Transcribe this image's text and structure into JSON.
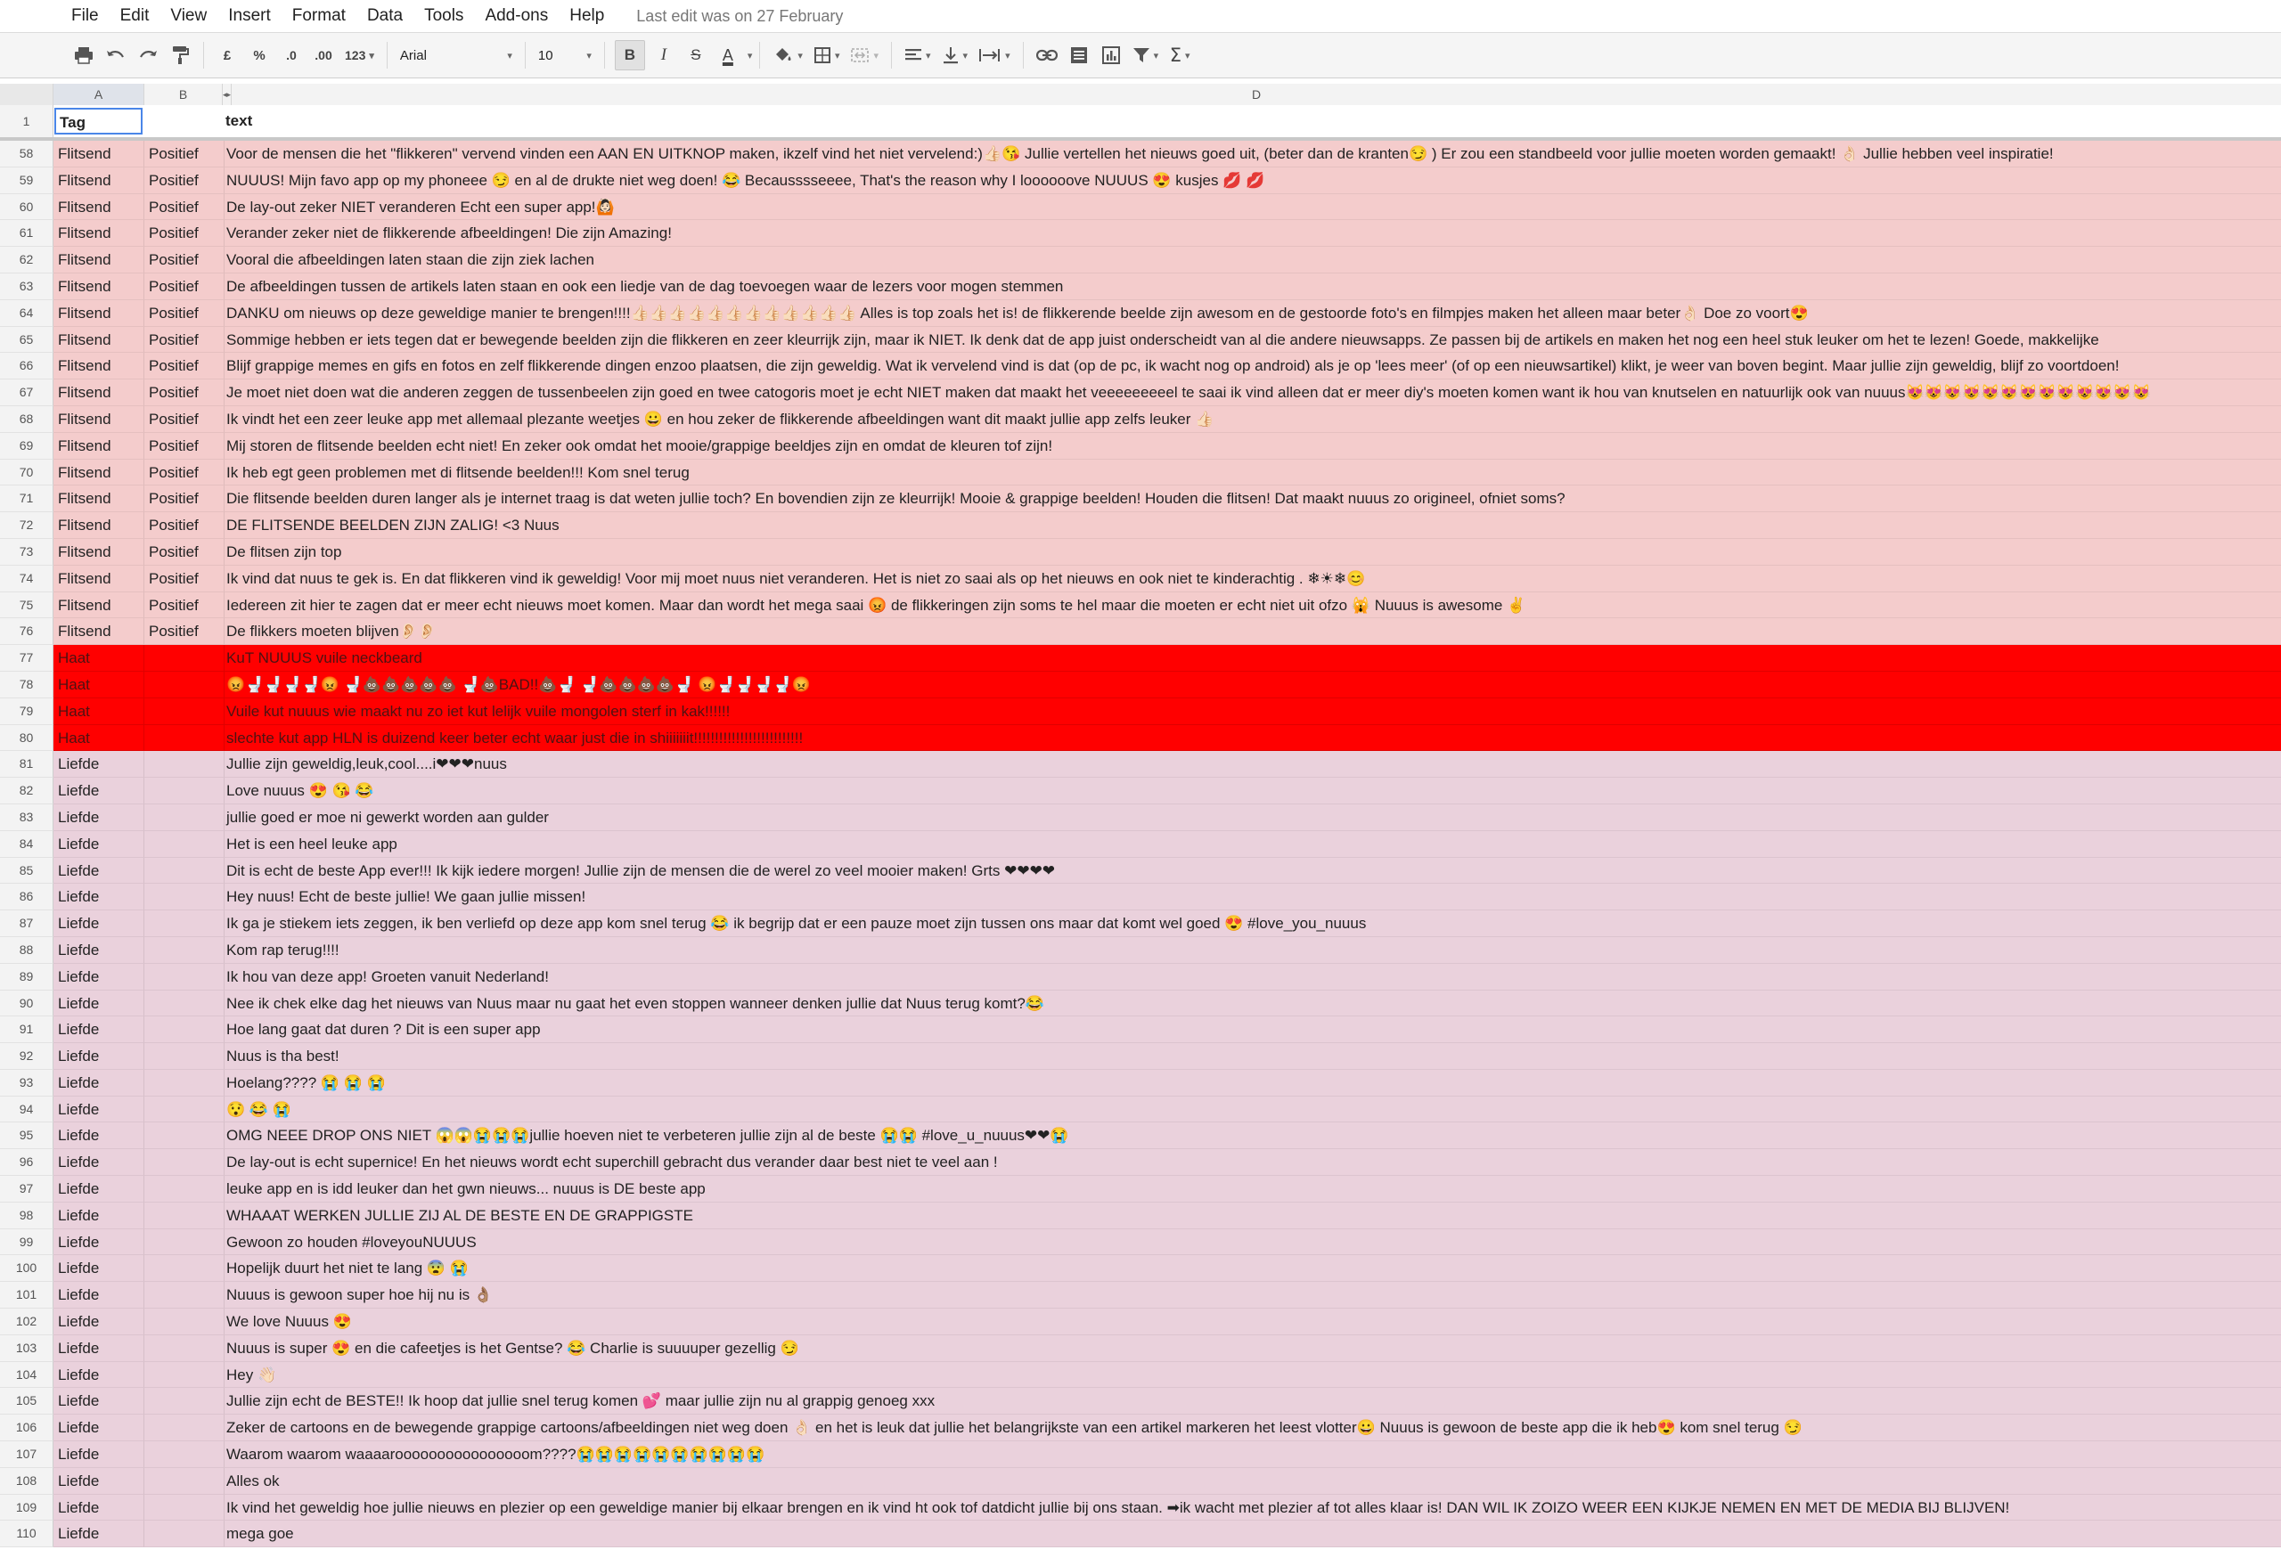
{
  "menu": {
    "items": [
      "File",
      "Edit",
      "View",
      "Insert",
      "Format",
      "Data",
      "Tools",
      "Add-ons",
      "Help"
    ],
    "last_edit": "Last edit was on 27 February"
  },
  "toolbar": {
    "currency": "£",
    "percent": "%",
    "dec_decrease": ".0",
    "dec_increase": ".00",
    "more_formats": "123",
    "font": "Arial",
    "font_size": "10",
    "bold": "B",
    "italic": "I",
    "strike": "S",
    "text_color": "A",
    "sum": "Σ"
  },
  "columns": {
    "a": "A",
    "b": "B",
    "d": "D",
    "hidden": "◂▸"
  },
  "header_row": {
    "num": "1",
    "a": "Tag",
    "d": "text"
  },
  "colors": {
    "flitsend": "#f4cccc",
    "haat": "#ff0000",
    "liefde": "#ead1dc",
    "selection": "#4a86e8"
  },
  "rows": [
    {
      "n": "58",
      "a": "Flitsend",
      "b": "Positief",
      "d": "Voor de mensen die het \"flikkeren\" vervend vinden een AAN EN UITKNOP maken, ikzelf vind het niet vervelend:)👍🏻😘  Jullie vertellen het nieuws goed uit, (beter dan de kranten😏 ) Er zou een standbeeld voor jullie moeten worden gemaakt! 👌🏻  Jullie hebben veel inspiratie!",
      "cls": "flits"
    },
    {
      "n": "59",
      "a": "Flitsend",
      "b": "Positief",
      "d": "NUUUS! Mijn favo app op my phoneee 😏  en al de drukte niet weg doen! 😂  Becausssseeee, That's the reason why I loooooove NUUUS 😍  kusjes 💋 💋",
      "cls": "flits"
    },
    {
      "n": "60",
      "a": "Flitsend",
      "b": "Positief",
      "d": "De lay-out zeker NIET veranderen Echt een super app!🙆🏻",
      "cls": "flits"
    },
    {
      "n": "61",
      "a": "Flitsend",
      "b": "Positief",
      "d": "Verander zeker niet de flikkerende afbeeldingen! Die zijn Amazing!",
      "cls": "flits"
    },
    {
      "n": "62",
      "a": "Flitsend",
      "b": "Positief",
      "d": "Vooral die afbeeldingen laten staan die zijn ziek lachen",
      "cls": "flits"
    },
    {
      "n": "63",
      "a": "Flitsend",
      "b": "Positief",
      "d": "De afbeeldingen tussen de artikels laten staan en ook een liedje van de dag toevoegen waar de lezers voor mogen stemmen",
      "cls": "flits"
    },
    {
      "n": "64",
      "a": "Flitsend",
      "b": "Positief",
      "d": "DANKU om nieuws op deze geweldige manier te brengen!!!!👍🏻👍🏻👍🏻👍🏻👍🏻👍🏻👍🏻👍🏻👍🏻👍🏻👍🏻👍🏻   Alles is top zoals het is! de flikkerende beelde zijn awesom en de gestoorde foto's en filmpjes maken het alleen maar beter👌🏻  Doe zo voort😍",
      "cls": "flits"
    },
    {
      "n": "65",
      "a": "Flitsend",
      "b": "Positief",
      "d": "Sommige hebben er iets tegen dat er bewegende beelden zijn die flikkeren en zeer kleurrijk zijn, maar ik NIET. Ik denk dat de app juist onderscheidt van al die andere nieuwsapps. Ze passen bij de artikels en maken het nog een heel stuk leuker om het te lezen! Goede, makkelijke",
      "cls": "flits"
    },
    {
      "n": "66",
      "a": "Flitsend",
      "b": "Positief",
      "d": "Blijf grappige memes en gifs en fotos en zelf flikkerende dingen enzoo plaatsen, die zijn geweldig. Wat ik vervelend vind is dat (op de pc, ik wacht nog op android) als je op 'lees meer' (of op een nieuwsartikel) klikt, je weer van boven begint. Maar jullie zijn geweldig, blijf zo voortdoen!",
      "cls": "flits"
    },
    {
      "n": "67",
      "a": "Flitsend",
      "b": "Positief",
      "d": "Je moet niet doen wat die anderen zeggen de tussenbeelen zijn goed en twee catogoris moet je echt NIET maken dat maakt het veeeeeeeeel te saai ik vind alleen dat er meer  diy's moeten komen want ik hou van knutselen en natuurlijk ook van nuuus😻😻😻😻😻😻😻😻😻😻😻😻😻",
      "cls": "flits"
    },
    {
      "n": "68",
      "a": "Flitsend",
      "b": "Positief",
      "d": "Ik vindt het een zeer leuke app met allemaal plezante weetjes 😀 en hou zeker de flikkerende afbeeldingen want dit maakt jullie app zelfs leuker 👍🏻",
      "cls": "flits"
    },
    {
      "n": "69",
      "a": "Flitsend",
      "b": "Positief",
      "d": "Mij storen de flitsende beelden echt niet! En zeker ook omdat het mooie/grappige beeldjes zijn en omdat de kleuren tof zijn!",
      "cls": "flits"
    },
    {
      "n": "70",
      "a": "Flitsend",
      "b": "Positief",
      "d": "Ik heb egt geen problemen met di flitsende beelden!!! Kom snel terug",
      "cls": "flits"
    },
    {
      "n": "71",
      "a": "Flitsend",
      "b": "Positief",
      "d": "Die flitsende beelden duren langer als je internet traag is dat weten jullie toch? En bovendien zijn ze kleurrijk! Mooie & grappige beelden! Houden die flitsen! Dat maakt nuuus zo origineel, ofniet soms?",
      "cls": "flits"
    },
    {
      "n": "72",
      "a": "Flitsend",
      "b": "Positief",
      "d": "DE FLITSENDE BEELDEN ZIJN ZALIG! <3 Nuus",
      "cls": "flits"
    },
    {
      "n": "73",
      "a": "Flitsend",
      "b": "Positief",
      "d": "De flitsen zijn top",
      "cls": "flits"
    },
    {
      "n": "74",
      "a": "Flitsend",
      "b": "Positief",
      "d": "Ik vind dat nuus te gek is. En dat flikkeren vind ik geweldig! Voor mij moet nuus niet veranderen. Het is niet zo saai als op het nieuws en ook niet te kinderachtig . ❄☀❄😊",
      "cls": "flits"
    },
    {
      "n": "75",
      "a": "Flitsend",
      "b": "Positief",
      "d": "Iedereen zit hier te zagen dat er meer echt nieuws moet komen. Maar dan wordt het mega saai 😡 de flikkeringen zijn soms te hel maar die moeten er echt niet uit ofzo 🙀 Nuuus is awesome ✌",
      "cls": "flits"
    },
    {
      "n": "76",
      "a": "Flitsend",
      "b": "Positief",
      "d": "De flikkers moeten blijven👂🏻👂🏻",
      "cls": "flits"
    },
    {
      "n": "77",
      "a": "Haat",
      "b": "",
      "d": "KuT NUUUS  vuile neckbeard",
      "cls": "haat"
    },
    {
      "n": "78",
      "a": "Haat",
      "b": "",
      "d": "😡🚽🚽🚽🚽😡   🚽💩💩💩💩💩   🚽💩BAD!!💩🚽   🚽💩💩💩💩🚽    😡🚽🚽🚽🚽😡",
      "cls": "haat"
    },
    {
      "n": "79",
      "a": "Haat",
      "b": "",
      "d": "Vuile kut nuuus wie maakt nu zo iet kut lelijk vuile mongolen sterf in kak!!!!!!",
      "cls": "haat"
    },
    {
      "n": "80",
      "a": "Haat",
      "b": "",
      "d": "slechte kut app HLN is duizend keer beter echt waar just die in shiiiiiiit!!!!!!!!!!!!!!!!!!!!!!!!!!",
      "cls": "haat"
    },
    {
      "n": "81",
      "a": "Liefde",
      "b": "",
      "d": "Jullie zijn geweldig,leuk,cool....i❤❤❤nuus",
      "cls": "liefde"
    },
    {
      "n": "82",
      "a": "Liefde",
      "b": "",
      "d": "Love nuuus 😍 😘 😂",
      "cls": "liefde"
    },
    {
      "n": "83",
      "a": "Liefde",
      "b": "",
      "d": "jullie goed er moe ni gewerkt worden aan gulder",
      "cls": "liefde"
    },
    {
      "n": "84",
      "a": "Liefde",
      "b": "",
      "d": "Het is een heel leuke app",
      "cls": "liefde"
    },
    {
      "n": "85",
      "a": "Liefde",
      "b": "",
      "d": "Dit is echt de beste App ever!!! Ik kijk iedere morgen! Jullie zijn de mensen die de werel zo veel mooier maken! Grts ❤❤❤❤",
      "cls": "liefde"
    },
    {
      "n": "86",
      "a": "Liefde",
      "b": "",
      "d": "Hey nuus! Echt de beste jullie! We gaan jullie missen!",
      "cls": "liefde"
    },
    {
      "n": "87",
      "a": "Liefde",
      "b": "",
      "d": "Ik ga je stiekem iets zeggen, ik ben verliefd op deze app kom snel terug 😂  ik begrijp dat er een pauze moet zijn tussen ons maar dat komt wel goed 😍  #love_you_nuuus",
      "cls": "liefde"
    },
    {
      "n": "88",
      "a": "Liefde",
      "b": "",
      "d": "Kom rap terug!!!!",
      "cls": "liefde"
    },
    {
      "n": "89",
      "a": "Liefde",
      "b": "",
      "d": "Ik hou van deze app! Groeten vanuit Nederland!",
      "cls": "liefde"
    },
    {
      "n": "90",
      "a": "Liefde",
      "b": "",
      "d": "Nee ik chek elke dag het nieuws van Nuus maar nu gaat het even stoppen wanneer denken jullie dat Nuus terug komt?😂",
      "cls": "liefde"
    },
    {
      "n": "91",
      "a": "Liefde",
      "b": "",
      "d": "Hoe lang gaat dat duren ?  Dit is een super app",
      "cls": "liefde"
    },
    {
      "n": "92",
      "a": "Liefde",
      "b": "",
      "d": "Nuus is tha best!",
      "cls": "liefde"
    },
    {
      "n": "93",
      "a": "Liefde",
      "b": "",
      "d": "Hoelang???? 😭 😭 😭",
      "cls": "liefde"
    },
    {
      "n": "94",
      "a": "Liefde",
      "b": "",
      "d": "😯 😂 😭",
      "cls": "liefde"
    },
    {
      "n": "95",
      "a": "Liefde",
      "b": "",
      "d": "OMG NEEE DROP ONS NIET 😱😱😭😭😭jullie hoeven niet te verbeteren jullie zijn al de beste 😭😭  #love_u_nuuus❤❤😭",
      "cls": "liefde"
    },
    {
      "n": "96",
      "a": "Liefde",
      "b": "",
      "d": "De lay-out is echt supernice! En het nieuws wordt echt superchill gebracht dus verander daar best niet te veel aan !",
      "cls": "liefde"
    },
    {
      "n": "97",
      "a": "Liefde",
      "b": "",
      "d": "leuke app en is idd leuker dan het gwn nieuws... nuuus is DE beste app",
      "cls": "liefde"
    },
    {
      "n": "98",
      "a": "Liefde",
      "b": "",
      "d": "WHAAAT WERKEN JULLIE ZIJ AL DE BESTE EN DE GRAPPIGSTE",
      "cls": "liefde"
    },
    {
      "n": "99",
      "a": "Liefde",
      "b": "",
      "d": "Gewoon zo houden #loveyouNUUUS",
      "cls": "liefde"
    },
    {
      "n": "100",
      "a": "Liefde",
      "b": "",
      "d": "Hopelijk duurt het niet te lang 😨 😭",
      "cls": "liefde"
    },
    {
      "n": "101",
      "a": "Liefde",
      "b": "",
      "d": "Nuuus is gewoon super hoe hij nu is 👌🏽",
      "cls": "liefde"
    },
    {
      "n": "102",
      "a": "Liefde",
      "b": "",
      "d": "We love Nuuus 😍",
      "cls": "liefde"
    },
    {
      "n": "103",
      "a": "Liefde",
      "b": "",
      "d": "Nuuus is super 😍  en die cafeetjes is het Gentse? 😂  Charlie is suuuuper gezellig 😏",
      "cls": "liefde"
    },
    {
      "n": "104",
      "a": "Liefde",
      "b": "",
      "d": "Hey 👋🏻",
      "cls": "liefde"
    },
    {
      "n": "105",
      "a": "Liefde",
      "b": "",
      "d": "Jullie zijn echt de BESTE!! Ik hoop dat jullie snel terug komen 💕  maar jullie zijn nu al grappig genoeg xxx",
      "cls": "liefde"
    },
    {
      "n": "106",
      "a": "Liefde",
      "b": "",
      "d": "Zeker de cartoons en de bewegende grappige cartoons/afbeeldingen niet weg doen 👌🏻  en het is leuk dat jullie het belangrijkste van een artikel markeren het leest vlotter😀  Nuuus is gewoon de beste app die ik heb😍  kom snel terug 😏",
      "cls": "liefde"
    },
    {
      "n": "107",
      "a": "Liefde",
      "b": "",
      "d": "Waarom waarom waaaaroooooooooooooooom????😭😭😭😭😭😭😭😭😭😭",
      "cls": "liefde"
    },
    {
      "n": "108",
      "a": "Liefde",
      "b": "",
      "d": "Alles ok",
      "cls": "liefde"
    },
    {
      "n": "109",
      "a": "Liefde",
      "b": "",
      "d": "Ik vind het geweldig hoe jullie nieuws en plezier op een geweldige manier bij elkaar brengen en ik vind ht ook tof datdicht jullie bij ons staan. ➡ik wacht met plezier af tot alles klaar is! DAN WIL IK ZOIZO WEER EEN KIJKJE NEMEN EN MET DE MEDIA BIJ BLIJVEN!",
      "cls": "liefde"
    },
    {
      "n": "110",
      "a": "Liefde",
      "b": "",
      "d": "mega goe",
      "cls": "liefde"
    }
  ]
}
